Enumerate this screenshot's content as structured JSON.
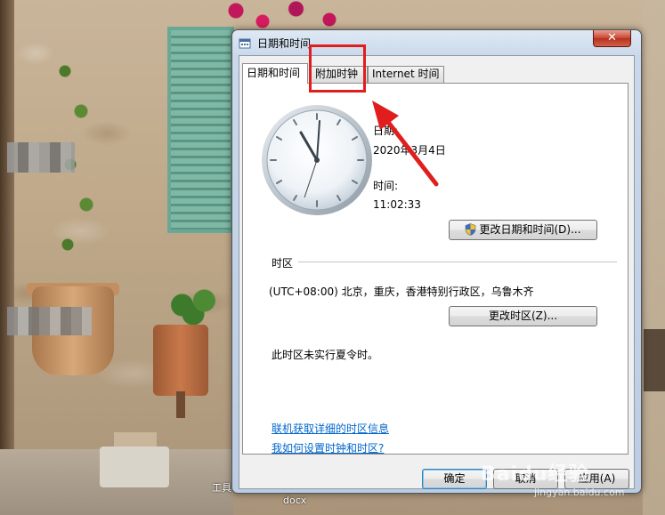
{
  "window": {
    "title": "日期和时间",
    "close_glyph": "✕"
  },
  "tabs": [
    {
      "label": "日期和时间",
      "active": true
    },
    {
      "label": "附加时钟",
      "active": false
    },
    {
      "label": "Internet 时间",
      "active": false
    }
  ],
  "datetime": {
    "date_label": "日期:",
    "date_value": "2020年3月4日",
    "time_label": "时间:",
    "time_value": "11:02:33",
    "change_datetime_button": "更改日期和时间(D)..."
  },
  "timezone": {
    "section_label": "时区",
    "value": "(UTC+08:00) 北京，重庆，香港特别行政区，乌鲁木齐",
    "change_timezone_button": "更改时区(Z)...",
    "dst_note": "此时区未实行夏令时。"
  },
  "links": {
    "online_info": "联机获取详细的时区信息",
    "how_to_set": "我如何设置时钟和时区?"
  },
  "footer": {
    "ok": "确定",
    "cancel": "取消",
    "apply": "应用(A)"
  },
  "desktop": {
    "icon_label": "工具",
    "taskbar_text": "docx",
    "watermark": "Baidu经验",
    "watermark_url": "jingyan.baidu.com"
  },
  "colors": {
    "annotation_red": "#e01e1e",
    "link_blue": "#0066cc"
  },
  "icons": {
    "title": "clock-calendar-icon",
    "shield": "uac-shield-icon",
    "close": "close-icon"
  }
}
